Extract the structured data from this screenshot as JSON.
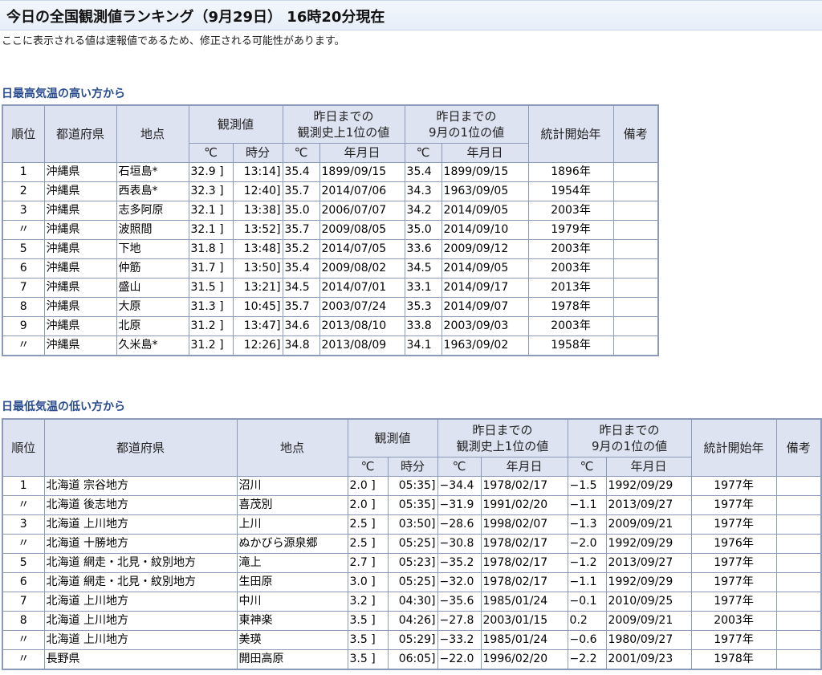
{
  "page": {
    "title": "今日の全国観測値ランキング（9月29日） 16時20分現在",
    "notice": "ここに表示される値は速報値であるため、修正される可能性があります。"
  },
  "headers": {
    "rank": "順位",
    "prefecture": "都道府県",
    "station": "地点",
    "observed": "観測値",
    "record_all_1": "昨日までの",
    "record_all_2": "観測史上1位の値",
    "record_month_1": "昨日までの",
    "record_month_2": "9月の1位の値",
    "stats_start": "統計開始年",
    "remarks": "備考",
    "unit_c": "℃",
    "time": "時分",
    "date": "年月日"
  },
  "high_table": {
    "title": "日最高気温の高い方から",
    "rows": [
      {
        "rank": "1",
        "pref": "沖縄県",
        "station": "石垣島*",
        "value": "32.9 ]",
        "time": "13:14]",
        "rec_all": "35.4",
        "rec_all_date": "1899/09/15",
        "rec_mon": "35.4",
        "rec_mon_date": "1899/09/15",
        "start": "1896年",
        "note": ""
      },
      {
        "rank": "2",
        "pref": "沖縄県",
        "station": "西表島*",
        "value": "32.3 ]",
        "time": "12:40]",
        "rec_all": "35.7",
        "rec_all_date": "2014/07/06",
        "rec_mon": "34.3",
        "rec_mon_date": "1963/09/05",
        "start": "1954年",
        "note": ""
      },
      {
        "rank": "3",
        "pref": "沖縄県",
        "station": "志多阿原",
        "value": "32.1 ]",
        "time": "13:38]",
        "rec_all": "35.0",
        "rec_all_date": "2006/07/07",
        "rec_mon": "34.2",
        "rec_mon_date": "2014/09/05",
        "start": "2003年",
        "note": ""
      },
      {
        "rank": "〃",
        "pref": "沖縄県",
        "station": "波照間",
        "value": "32.1 ]",
        "time": "13:52]",
        "rec_all": "35.7",
        "rec_all_date": "2009/08/05",
        "rec_mon": "35.0",
        "rec_mon_date": "2014/09/10",
        "start": "1979年",
        "note": ""
      },
      {
        "rank": "5",
        "pref": "沖縄県",
        "station": "下地",
        "value": "31.8 ]",
        "time": "13:48]",
        "rec_all": "35.2",
        "rec_all_date": "2014/07/05",
        "rec_mon": "33.6",
        "rec_mon_date": "2009/09/12",
        "start": "2003年",
        "note": ""
      },
      {
        "rank": "6",
        "pref": "沖縄県",
        "station": "仲筋",
        "value": "31.7 ]",
        "time": "13:50]",
        "rec_all": "35.4",
        "rec_all_date": "2009/08/02",
        "rec_mon": "34.5",
        "rec_mon_date": "2014/09/05",
        "start": "2003年",
        "note": ""
      },
      {
        "rank": "7",
        "pref": "沖縄県",
        "station": "盛山",
        "value": "31.5 ]",
        "time": "13:21]",
        "rec_all": "34.5",
        "rec_all_date": "2014/07/01",
        "rec_mon": "33.1",
        "rec_mon_date": "2014/09/17",
        "start": "2013年",
        "note": ""
      },
      {
        "rank": "8",
        "pref": "沖縄県",
        "station": "大原",
        "value": "31.3 ]",
        "time": "10:45]",
        "rec_all": "35.7",
        "rec_all_date": "2003/07/24",
        "rec_mon": "35.3",
        "rec_mon_date": "2014/09/07",
        "start": "1978年",
        "note": ""
      },
      {
        "rank": "9",
        "pref": "沖縄県",
        "station": "北原",
        "value": "31.2 ]",
        "time": "13:47]",
        "rec_all": "34.6",
        "rec_all_date": "2013/08/10",
        "rec_mon": "33.8",
        "rec_mon_date": "2003/09/03",
        "start": "2003年",
        "note": ""
      },
      {
        "rank": "〃",
        "pref": "沖縄県",
        "station": "久米島*",
        "value": "31.2 ]",
        "time": "12:26]",
        "rec_all": "34.8",
        "rec_all_date": "2013/08/09",
        "rec_mon": "34.1",
        "rec_mon_date": "1963/09/02",
        "start": "1958年",
        "note": ""
      }
    ]
  },
  "low_table": {
    "title": "日最低気温の低い方から",
    "rows": [
      {
        "rank": "1",
        "pref": "北海道 宗谷地方",
        "station": "沼川",
        "value": "2.0 ]",
        "time": "05:35]",
        "rec_all": "−34.4",
        "rec_all_date": "1978/02/17",
        "rec_mon": "−1.5",
        "rec_mon_date": "1992/09/29",
        "start": "1977年",
        "note": ""
      },
      {
        "rank": "〃",
        "pref": "北海道 後志地方",
        "station": "喜茂別",
        "value": "2.0 ]",
        "time": "05:35]",
        "rec_all": "−31.9",
        "rec_all_date": "1991/02/20",
        "rec_mon": "−1.1",
        "rec_mon_date": "2013/09/27",
        "start": "1977年",
        "note": ""
      },
      {
        "rank": "3",
        "pref": "北海道 上川地方",
        "station": "上川",
        "value": "2.5 ]",
        "time": "03:50]",
        "rec_all": "−28.6",
        "rec_all_date": "1998/02/07",
        "rec_mon": "−1.3",
        "rec_mon_date": "2009/09/21",
        "start": "1977年",
        "note": ""
      },
      {
        "rank": "〃",
        "pref": "北海道 十勝地方",
        "station": "ぬかびら源泉郷",
        "value": "2.5 ]",
        "time": "05:25]",
        "rec_all": "−30.8",
        "rec_all_date": "1978/02/17",
        "rec_mon": "−2.0",
        "rec_mon_date": "1992/09/29",
        "start": "1976年",
        "note": ""
      },
      {
        "rank": "5",
        "pref": "北海道 網走・北見・紋別地方",
        "station": "滝上",
        "value": "2.7 ]",
        "time": "05:23]",
        "rec_all": "−35.2",
        "rec_all_date": "1978/02/17",
        "rec_mon": "−1.2",
        "rec_mon_date": "2013/09/27",
        "start": "1977年",
        "note": ""
      },
      {
        "rank": "6",
        "pref": "北海道 網走・北見・紋別地方",
        "station": "生田原",
        "value": "3.0 ]",
        "time": "05:25]",
        "rec_all": "−32.0",
        "rec_all_date": "1978/02/17",
        "rec_mon": "−1.1",
        "rec_mon_date": "1992/09/29",
        "start": "1977年",
        "note": ""
      },
      {
        "rank": "7",
        "pref": "北海道 上川地方",
        "station": "中川",
        "value": "3.2 ]",
        "time": "04:30]",
        "rec_all": "−35.6",
        "rec_all_date": "1985/01/24",
        "rec_mon": "−0.1",
        "rec_mon_date": "2010/09/25",
        "start": "1977年",
        "note": ""
      },
      {
        "rank": "8",
        "pref": "北海道 上川地方",
        "station": "東神楽",
        "value": "3.5 ]",
        "time": "04:26]",
        "rec_all": "−27.8",
        "rec_all_date": "2003/01/15",
        "rec_mon": "0.2",
        "rec_mon_date": "2009/09/21",
        "start": "2003年",
        "note": ""
      },
      {
        "rank": "〃",
        "pref": "北海道 上川地方",
        "station": "美瑛",
        "value": "3.5 ]",
        "time": "05:29]",
        "rec_all": "−33.2",
        "rec_all_date": "1985/01/24",
        "rec_mon": "−0.6",
        "rec_mon_date": "1980/09/27",
        "start": "1977年",
        "note": ""
      },
      {
        "rank": "〃",
        "pref": "長野県",
        "station": "開田高原",
        "value": "3.5 ]",
        "time": "06:05]",
        "rec_all": "−22.0",
        "rec_all_date": "1996/02/20",
        "rec_mon": "−2.2",
        "rec_mon_date": "2001/09/23",
        "start": "1978年",
        "note": ""
      }
    ]
  }
}
